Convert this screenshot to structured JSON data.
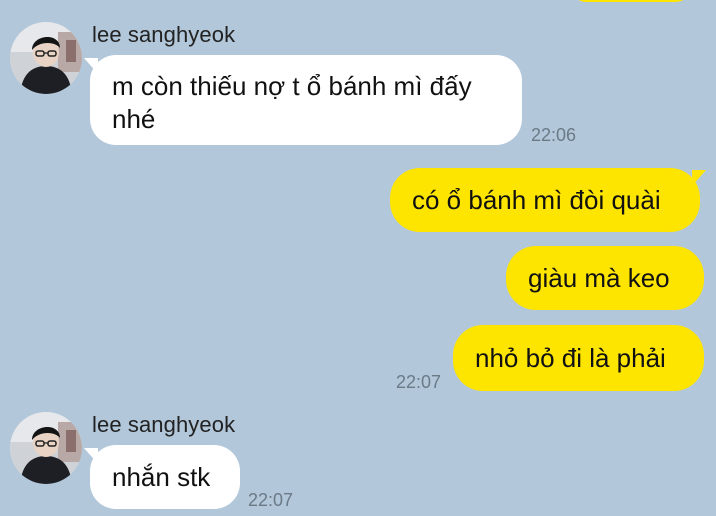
{
  "contact": {
    "name": "lee sanghyeok"
  },
  "messages": [
    {
      "id": 1,
      "direction": "in",
      "sender": "lee sanghyeok",
      "text": "m còn thiếu nợ t ổ bánh mì đấy nhé",
      "time": "22:06"
    },
    {
      "id": 2,
      "direction": "out",
      "text": "có ổ bánh mì đòi quài"
    },
    {
      "id": 3,
      "direction": "out",
      "text": "giàu mà keo"
    },
    {
      "id": 4,
      "direction": "out",
      "text": "nhỏ bỏ đi là phải",
      "time": "22:07"
    },
    {
      "id": 5,
      "direction": "in",
      "sender": "lee sanghyeok",
      "text": "nhắn stk",
      "time": "22:07"
    }
  ],
  "colors": {
    "background": "#b2c7d9",
    "incoming_bubble": "#ffffff",
    "outgoing_bubble": "#fee500",
    "timestamp": "#6b7a87"
  }
}
